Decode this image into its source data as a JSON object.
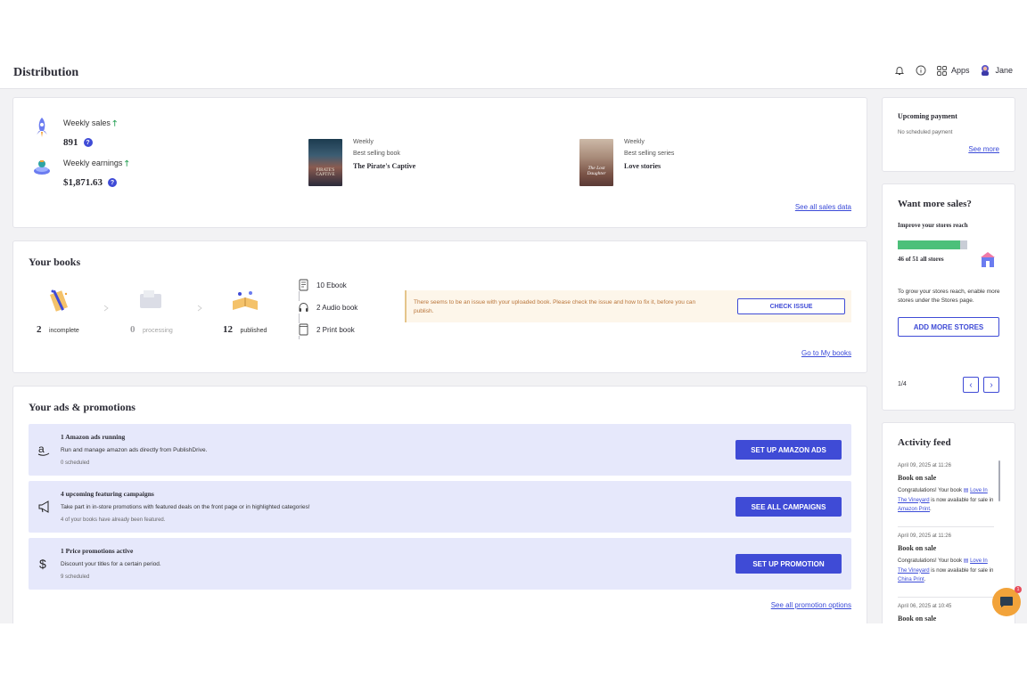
{
  "header": {
    "title": "Distribution",
    "apps_label": "Apps",
    "user_name": "Jane"
  },
  "stats": {
    "weekly_sales_label": "Weekly sales",
    "weekly_sales_value": "891",
    "weekly_earnings_label": "Weekly earnings",
    "weekly_earnings_value": "$1,871.63",
    "best_book": {
      "period": "Weekly",
      "label": "Best selling book",
      "title": "The Pirate's Captive",
      "cover_text": "PIRATE'S CAPTIVE"
    },
    "best_series": {
      "period": "Weekly",
      "label": "Best selling series",
      "title": "Love stories",
      "cover_text": "The Lost Daughter"
    },
    "see_all_link": "See all sales data"
  },
  "books": {
    "title": "Your books",
    "stages": [
      {
        "count": "2",
        "label": "incomplete"
      },
      {
        "count": "0",
        "label": "processing"
      },
      {
        "count": "12",
        "label": "published"
      }
    ],
    "formats": [
      {
        "icon": "ebook-icon",
        "label": "10 Ebook"
      },
      {
        "icon": "headphones-icon",
        "label": "2 Audio book"
      },
      {
        "icon": "print-book-icon",
        "label": "2 Print book"
      }
    ],
    "issue_text": "There seems to be an issue with your uploaded book. Please check the issue and how to fix it, before you can publish.",
    "check_issue_button": "CHECK ISSUE",
    "go_link": "Go to My books"
  },
  "ads": {
    "title": "Your ads & promotions",
    "items": [
      {
        "icon": "amazon-icon",
        "title": "1 Amazon ads running",
        "desc": "Run and manage amazon ads directly from PublishDrive.",
        "sub": "0 scheduled",
        "button": "SET UP AMAZON ADS"
      },
      {
        "icon": "megaphone-icon",
        "title": "4 upcoming featuring campaigns",
        "desc": "Take part in in-store promotions with featured deals on the front page or in highlighted categories!",
        "sub": "4 of your books have already been featured.",
        "button": "SEE ALL CAMPAIGNS"
      },
      {
        "icon": "dollar-icon",
        "title": "1 Price promotions active",
        "desc": "Discount your titles for a certain period.",
        "sub": "9 scheduled",
        "button": "SET UP PROMOTION"
      }
    ],
    "see_all_link": "See all promotion options"
  },
  "payment": {
    "title": "Upcoming payment",
    "text": "No scheduled payment",
    "link": "See more"
  },
  "sales": {
    "title": "Want more sales?",
    "subtitle": "Improve your stores reach",
    "progress_fraction": 0.902,
    "progress_text": "46 of 51 all stores",
    "desc": "To grow your stores reach, enable more stores under the Stores page.",
    "button": "ADD MORE STORES",
    "pager": "1/4"
  },
  "activity": {
    "title": "Activity feed",
    "items": [
      {
        "date": "April 09, 2025 at 11:26",
        "title": "Book on sale",
        "pre": "Congratulations! Your book",
        "book": "Love In The Vineyard",
        "mid": "is now available for sale in",
        "store": "Amazon Print",
        "end": "."
      },
      {
        "date": "April 09, 2025 at 11:26",
        "title": "Book on sale",
        "pre": "Congratulations! Your book",
        "book": "Love In The Vineyard",
        "mid": "is now available for sale in",
        "store": "China Print",
        "end": "."
      },
      {
        "date": "April 06, 2025 at 10:45",
        "title": "Book on sale"
      }
    ]
  },
  "chat": {
    "badge": "1"
  }
}
